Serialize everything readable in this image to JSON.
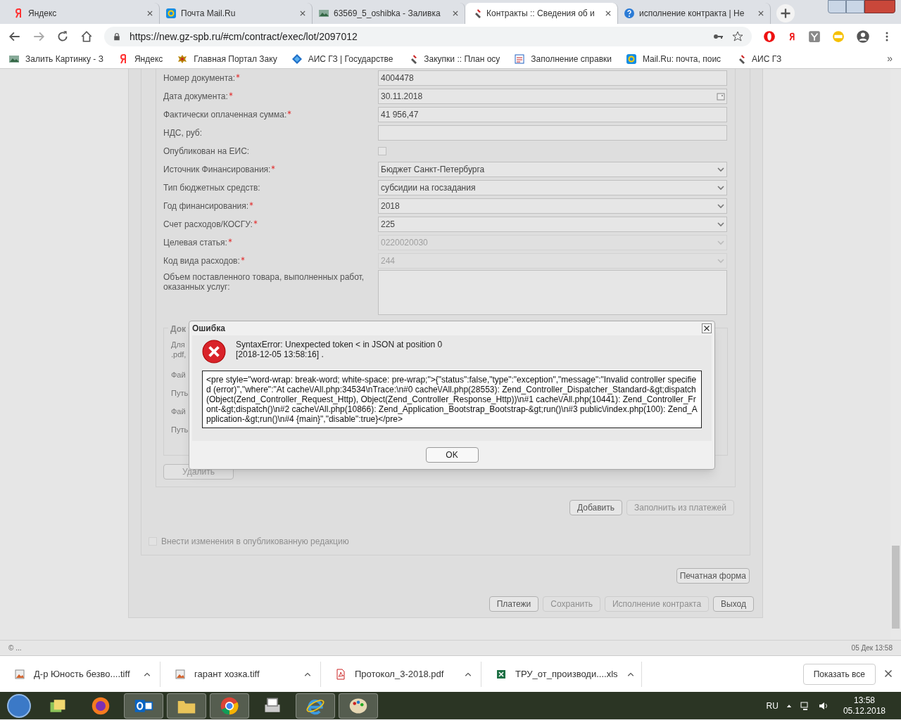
{
  "browser": {
    "tabs": [
      {
        "title": "Яндекс",
        "kind": "yandex",
        "selected": false
      },
      {
        "title": "Почта Mail.Ru",
        "kind": "mail",
        "selected": false
      },
      {
        "title": "63569_5_oshibka - Заливка",
        "kind": "photo",
        "selected": false
      },
      {
        "title": "Контракты :: Сведения об и",
        "kind": "tools",
        "selected": true
      },
      {
        "title": "исполнение контракта | Не",
        "kind": "help",
        "selected": false
      }
    ],
    "address": "https://new.gz-spb.ru/#cm/contract/exec/lot/2097012",
    "bookmarks": [
      {
        "label": "Залить Картинку - З",
        "kind": "photo"
      },
      {
        "label": "Яндекс",
        "kind": "yandex"
      },
      {
        "label": "Главная Портал Заку",
        "kind": "emblem"
      },
      {
        "label": "АИС ГЗ | Государстве",
        "kind": "diamond"
      },
      {
        "label": "Закупки :: План осу",
        "kind": "tools"
      },
      {
        "label": "Заполнение справки",
        "kind": "doc"
      },
      {
        "label": "Mail.Ru: почта, поис",
        "kind": "mail"
      },
      {
        "label": "АИС ГЗ",
        "kind": "tools"
      }
    ],
    "bookmarks_more": "»"
  },
  "form": {
    "fields": [
      {
        "label": "Номер документа:",
        "required": true,
        "kind": "text",
        "value": "4004478",
        "disabled": false
      },
      {
        "label": "Дата документа:",
        "required": true,
        "kind": "date",
        "value": "30.11.2018",
        "disabled": false
      },
      {
        "label": "Фактически оплаченная сумма:",
        "required": true,
        "kind": "text",
        "value": "41 956,47",
        "disabled": false
      },
      {
        "label": "НДС, руб:",
        "required": false,
        "kind": "text",
        "disabled": false
      },
      {
        "label": "Опубликован на ЕИС:",
        "required": false,
        "kind": "checkbox",
        "checked": false,
        "disabled": false
      },
      {
        "label": "Источник Финансирования:",
        "required": true,
        "kind": "select",
        "value": "Бюджет Санкт-Петербурга",
        "disabled": false
      },
      {
        "label": "Тип бюджетных средств:",
        "required": false,
        "kind": "select",
        "value": "субсидии на госзадания",
        "disabled": false
      },
      {
        "label": "Год финансирования:",
        "required": true,
        "kind": "select",
        "value": "2018",
        "disabled": false
      },
      {
        "label": "Счет расходов/КОСГУ:",
        "required": true,
        "kind": "select",
        "value": "225",
        "disabled": false
      },
      {
        "label": "Целевая статья:",
        "required": true,
        "kind": "select",
        "value": "0220020030",
        "disabled": true
      },
      {
        "label": "Код вида расходов:",
        "required": true,
        "kind": "select",
        "value": "244",
        "disabled": true
      },
      {
        "label": "Объем поставленного товара, выполненных работ, оказанных услуг:",
        "required": false,
        "kind": "textarea",
        "disabled": false
      }
    ],
    "attachments": {
      "legend": "Док",
      "note_lines": [
        "Для",
        ".pdf,"
      ],
      "row_labels": [
        "Фай",
        "Путь",
        "Фай",
        "Путь"
      ]
    },
    "delete_button": "Удалить",
    "add_button": {
      "label": "Добавить",
      "disabled": false
    },
    "fill_button": {
      "label": "Заполнить из платежей",
      "disabled": true
    },
    "publish_changes": {
      "label": "Внести изменения в опубликованную редакцию",
      "checked": false,
      "disabled": true
    },
    "print_button": "Печатная форма",
    "footer_buttons": [
      {
        "label": "Платежи",
        "disabled": false
      },
      {
        "label": "Сохранить",
        "disabled": true
      },
      {
        "label": "Исполнение контракта",
        "disabled": true
      },
      {
        "label": "Выход",
        "disabled": false
      }
    ]
  },
  "status_bar": {
    "left": "© ...",
    "right": "05 Дек 13:58"
  },
  "dialog": {
    "title": "Ошибка",
    "message": "SyntaxError: Unexpected token < in JSON at position 0",
    "timestamp": "[2018-12-05 13:58:16] .",
    "detail": "<pre style=\"word-wrap: break-word; white-space: pre-wrap;\">{\"status\":false,\"type\":\"exception\",\"message\":\"Invalid controller specified (error)\",\"where\":\"At cache\\/All.php:34534\\nTrace:\\n#0 cache\\/All.php(28553): Zend_Controller_Dispatcher_Standard-&gt;dispatch(Object(Zend_Controller_Request_Http), Object(Zend_Controller_Response_Http))\\n#1 cache\\/All.php(10441): Zend_Controller_Front-&gt;dispatch()\\n#2 cache\\/All.php(10866): Zend_Application_Bootstrap_Bootstrap-&gt;run()\\n#3 public\\/index.php(100): Zend_Application-&gt;run()\\n#4 {main}\",\"disable\":true}</pre>",
    "ok_button": "OK"
  },
  "downloads": {
    "items": [
      {
        "name": "Д-р Юность безво....tiff",
        "kind": "image"
      },
      {
        "name": "гарант хозка.tiff",
        "kind": "image"
      },
      {
        "name": "Протокол_3-2018.pdf",
        "kind": "pdf"
      },
      {
        "name": "ТРУ_от_производи....xls",
        "kind": "excel"
      }
    ],
    "show_all": "Показать все"
  },
  "taskbar": {
    "apps": [
      {
        "kind": "folders",
        "active": false
      },
      {
        "kind": "firefox",
        "active": false
      },
      {
        "kind": "outlook",
        "active": true
      },
      {
        "kind": "explorer",
        "active": true
      },
      {
        "kind": "chrome",
        "active": true
      },
      {
        "kind": "fax",
        "active": false
      },
      {
        "kind": "ie",
        "active": true
      },
      {
        "kind": "paint",
        "active": true
      }
    ],
    "language": "RU",
    "time": "13:58",
    "date": "05.12.2018"
  }
}
